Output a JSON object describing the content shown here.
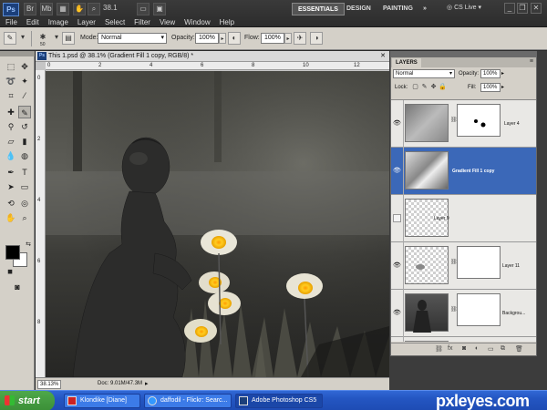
{
  "app": {
    "logo": "Ps",
    "zoom_display": "38.1",
    "menus": [
      "File",
      "Edit",
      "Image",
      "Layer",
      "Select",
      "Filter",
      "View",
      "Window",
      "Help"
    ],
    "workspaces": [
      "ESSENTIALS",
      "DESIGN",
      "PAINTING"
    ],
    "more": "»",
    "cs_live": "CS Live"
  },
  "options": {
    "brush_size": "50",
    "mode_label": "Mode:",
    "mode_value": "Normal",
    "opacity_label": "Opacity:",
    "opacity_value": "100%",
    "flow_label": "Flow:",
    "flow_value": "100%"
  },
  "document": {
    "tab_title": "This 1.psd @ 38.1% (Gradient Fill 1 copy, RGB/8) *",
    "ruler_top": [
      "0",
      "2",
      "4",
      "6",
      "8",
      "10",
      "12"
    ],
    "ruler_left": [
      "0",
      "2",
      "4",
      "6",
      "8"
    ],
    "zoom_status": "38.13%",
    "doc_info": "Doc: 9.01M/47.3M"
  },
  "layers_panel": {
    "tab": "LAYERS",
    "blend_mode": "Normal",
    "opacity_label": "Opacity:",
    "opacity_value": "100%",
    "lock_label": "Lock:",
    "fill_label": "Fill:",
    "fill_value": "100%",
    "layers": [
      {
        "name": "Layer 4",
        "visible": true,
        "selected": false
      },
      {
        "name": "Gradient Fill 1 copy",
        "visible": true,
        "selected": true
      },
      {
        "name": "Layer 9",
        "visible": false,
        "selected": false
      },
      {
        "name": "Layer 11",
        "visible": true,
        "selected": false
      },
      {
        "name": "Backgrou...",
        "visible": true,
        "selected": false
      }
    ]
  },
  "taskbar": {
    "start": "start",
    "items": [
      "Klondike [Diane]",
      "daffodil - Flickr: Searc...",
      "Adobe Photoshop CS5"
    ]
  },
  "watermark": "pxleyes.com"
}
